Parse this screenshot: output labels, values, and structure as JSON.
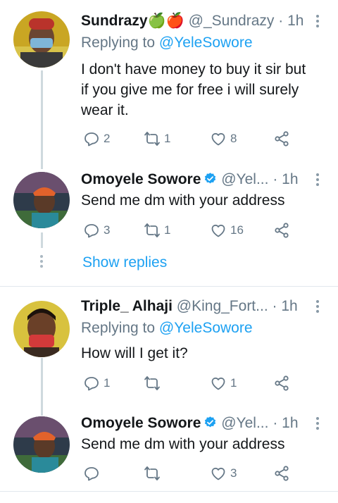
{
  "tweets": [
    {
      "name": "Sundrazy",
      "emoji": "🍏🍎",
      "handle": "@_Sundrazy",
      "sep": "·",
      "time": "1h",
      "reply_prefix": "Replying to",
      "reply_handle": "@YeleSowore",
      "text": "I don't have money to buy it sir but if you give me for free i will surely wear it.",
      "replies": "2",
      "retweets": "1",
      "likes": "8"
    },
    {
      "name": "Omoyele Sowore",
      "handle": "@Yel...",
      "sep": "·",
      "time": "1h",
      "text": "Send me dm with your address",
      "replies": "3",
      "retweets": "1",
      "likes": "16"
    },
    {
      "name": "Triple_ Alhaji",
      "handle": "@King_Fort...",
      "sep": "·",
      "time": "1h",
      "reply_prefix": "Replying to",
      "reply_handle": "@YeleSowore",
      "text": "How will I get it?",
      "replies": "1",
      "retweets": "",
      "likes": "1"
    },
    {
      "name": "Omoyele Sowore",
      "handle": "@Yel...",
      "sep": "·",
      "time": "1h",
      "text": "Send me dm with your address",
      "replies": "",
      "retweets": "",
      "likes": "3"
    }
  ],
  "show_replies": "Show replies",
  "colors": {
    "accent": "#1da1f2",
    "muted": "#657786",
    "thread": "#cfd9de"
  }
}
